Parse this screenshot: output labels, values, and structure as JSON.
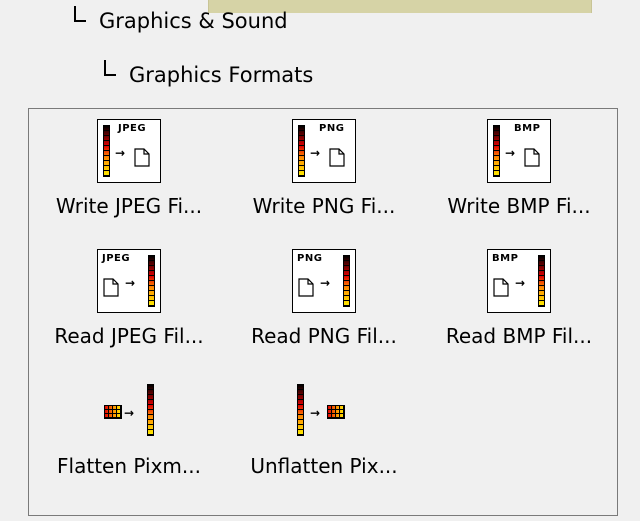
{
  "breadcrumb": {
    "level1": "Graphics & Sound",
    "level2": "Graphics Formats"
  },
  "palette": {
    "items": [
      {
        "label": "Write JPEG Fi...",
        "format": "JPEG",
        "icon": "write-jpeg-icon"
      },
      {
        "label": "Write PNG Fi...",
        "format": "PNG",
        "icon": "write-png-icon"
      },
      {
        "label": "Write BMP Fi...",
        "format": "BMP",
        "icon": "write-bmp-icon"
      },
      {
        "label": "Read JPEG Fil...",
        "format": "JPEG",
        "icon": "read-jpeg-icon"
      },
      {
        "label": "Read PNG Fil...",
        "format": "PNG",
        "icon": "read-png-icon"
      },
      {
        "label": "Read BMP Fil...",
        "format": "BMP",
        "icon": "read-bmp-icon"
      },
      {
        "label": "Flatten Pixm...",
        "icon": "flatten-pixmap-icon"
      },
      {
        "label": "Unflatten Pix...",
        "icon": "unflatten-pixmap-icon"
      }
    ]
  },
  "colors": {
    "tab_highlight": "#d6d3a6",
    "panel_border": "#7a7a7a",
    "background": "#f0f0f0"
  }
}
